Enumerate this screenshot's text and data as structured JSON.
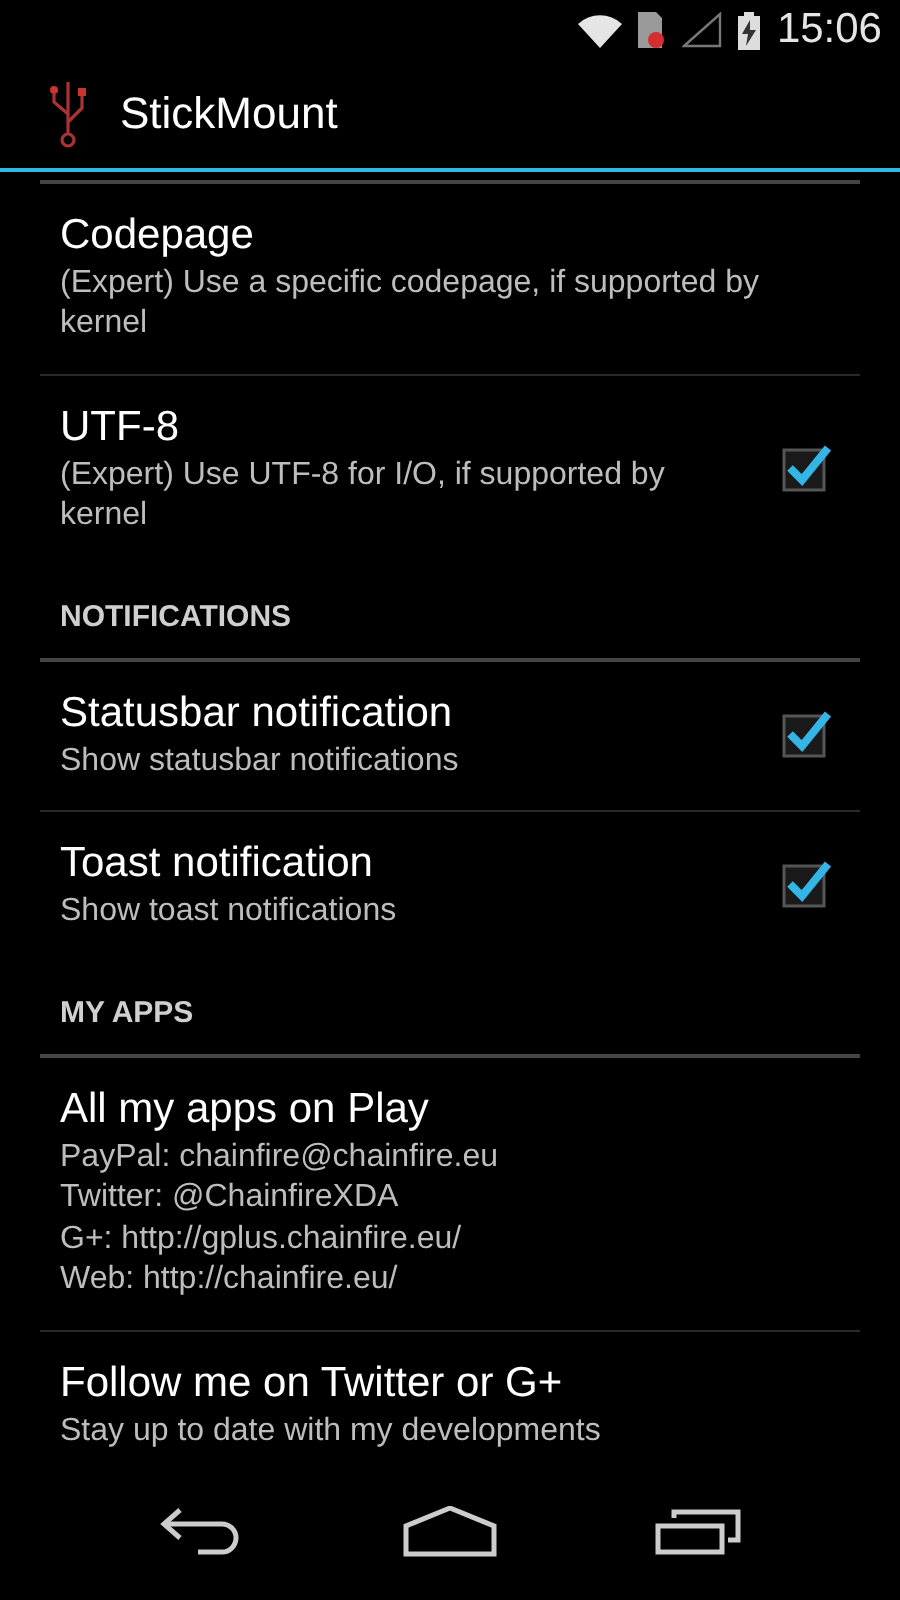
{
  "status_bar": {
    "time": "15:06"
  },
  "action_bar": {
    "title": "StickMount"
  },
  "preferences": [
    {
      "kind": "plain",
      "title": "Codepage",
      "summary": [
        "(Expert) Use a specific codepage, if supported by kernel"
      ]
    },
    {
      "kind": "checkbox",
      "title": "UTF-8",
      "summary": [
        "(Expert) Use UTF-8 for I/O, if supported by kernel"
      ],
      "checked": true
    },
    {
      "kind": "category",
      "title": "NOTIFICATIONS"
    },
    {
      "kind": "checkbox",
      "title": "Statusbar notification",
      "summary": [
        "Show statusbar notifications"
      ],
      "checked": true
    },
    {
      "kind": "checkbox",
      "title": "Toast notification",
      "summary": [
        "Show toast notifications"
      ],
      "checked": true
    },
    {
      "kind": "category",
      "title": "MY APPS"
    },
    {
      "kind": "plain",
      "title": "All my apps on Play",
      "summary": [
        "PayPal: chainfire@chainfire.eu",
        "Twitter: @ChainfireXDA",
        "G+: http://gplus.chainfire.eu/",
        "Web: http://chainfire.eu/"
      ]
    },
    {
      "kind": "plain",
      "title": "Follow me on Twitter or G+",
      "summary": [
        "Stay up to date with my developments"
      ]
    }
  ]
}
